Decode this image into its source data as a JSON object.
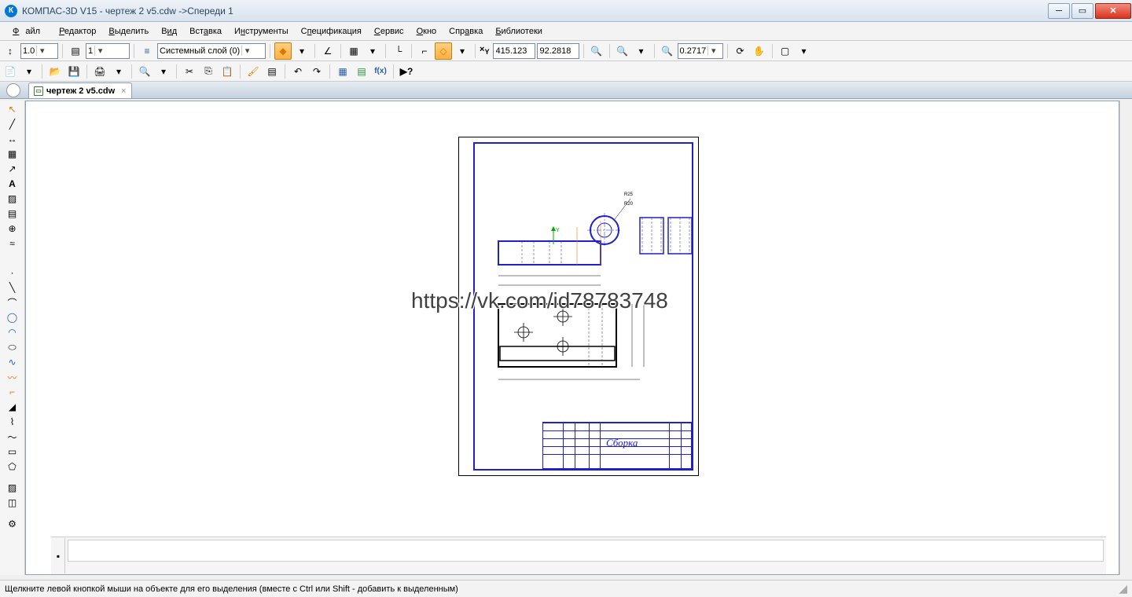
{
  "window": {
    "title": "КОМПАС-3D V15 - чертеж 2 v5.cdw ->Спереди 1"
  },
  "menu": {
    "file": "Файл",
    "edit": "Редактор",
    "select": "Выделить",
    "view": "Вид",
    "insert": "Вставка",
    "tools": "Инструменты",
    "spec": "Спецификация",
    "service": "Сервис",
    "window": "Окно",
    "help": "Справка",
    "libs": "Библиотеки"
  },
  "toolbar1": {
    "scale": "1.0",
    "layer_num": "1",
    "layer_name": "Системный слой (0)",
    "coord_x_label": "X",
    "coord_x": "415.123",
    "coord_y": "92.2818",
    "zoom": "0.2717"
  },
  "tab": {
    "filename": "чертеж 2 v5.cdw"
  },
  "drawing": {
    "title": "Сборка"
  },
  "watermark": "https://vk.com/id78783748",
  "status": {
    "hint": "Щелкните левой кнопкой мыши на объекте для его выделения (вместе с Ctrl или Shift - добавить к выделенным)"
  }
}
